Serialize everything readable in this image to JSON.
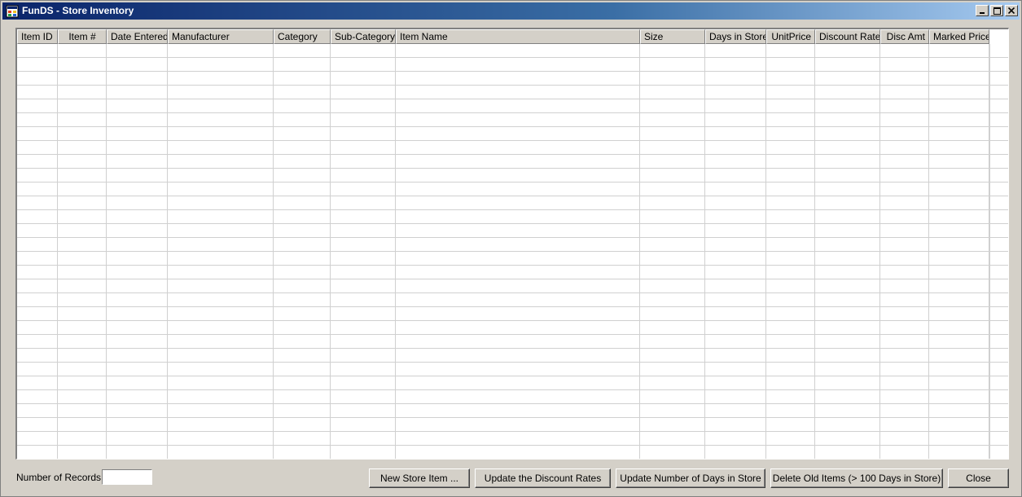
{
  "window": {
    "title": "FunDS - Store Inventory",
    "icon": "app-window-icon",
    "controls": [
      "minimize-icon",
      "maximize-icon",
      "close-icon"
    ]
  },
  "grid": {
    "columns": [
      {
        "label": "Item ID",
        "align": "left"
      },
      {
        "label": "Item #",
        "align": "center"
      },
      {
        "label": "Date Entered",
        "align": "center"
      },
      {
        "label": "Manufacturer",
        "align": "left"
      },
      {
        "label": "Category",
        "align": "left"
      },
      {
        "label": "Sub-Category",
        "align": "left"
      },
      {
        "label": "Item Name",
        "align": "left"
      },
      {
        "label": "Size",
        "align": "left"
      },
      {
        "label": "Days in Store",
        "align": "right"
      },
      {
        "label": "UnitPrice",
        "align": "right"
      },
      {
        "label": "Discount Rate",
        "align": "right"
      },
      {
        "label": "Disc Amt",
        "align": "right"
      },
      {
        "label": "Marked Price",
        "align": "right"
      }
    ],
    "rows": []
  },
  "footer": {
    "records_label": "Number of Records:",
    "records_value": "",
    "buttons": {
      "new_item": "New Store Item ...",
      "update_discount": "Update the Discount Rates",
      "update_days": "Update Number of Days in Store",
      "delete_old": "Delete Old Items (> 100 Days in Store)",
      "close": "Close"
    }
  },
  "colors": {
    "title_start": "#0a246a",
    "title_end": "#a6caf0",
    "face": "#d4d0c8",
    "grid_line": "#d0d0d0"
  }
}
